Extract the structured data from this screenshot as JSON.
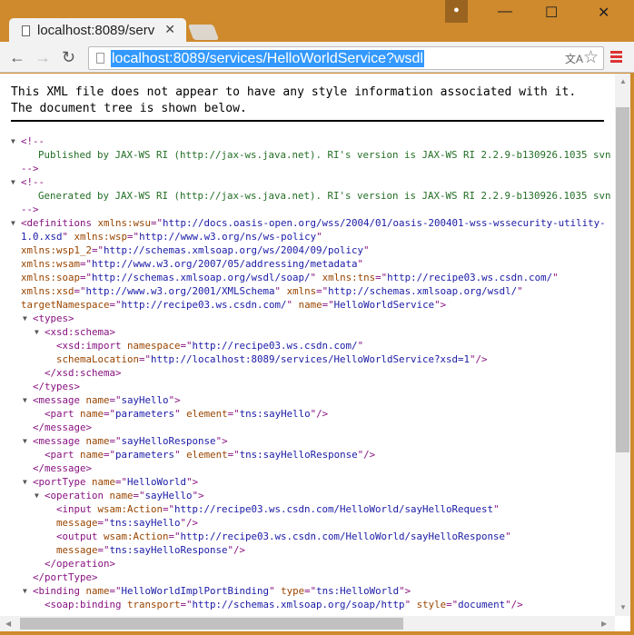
{
  "browser": {
    "tab_title": "localhost:8089/serv",
    "url": "localhost:8089/services/HelloWorldService?wsdl",
    "accent": "#cf8a2d",
    "selection_color": "#3399ff"
  },
  "notice": {
    "line1": "This XML file does not appear to have any style information associated with it.",
    "line2": "The document tree is shown below."
  },
  "colors": {
    "tag": "#881280",
    "attr_name": "#994500",
    "attr_value": "#1a1aa6",
    "comment": "#236e25"
  },
  "lines": [
    {
      "d": 0,
      "a": 1,
      "t": [
        [
          "g",
          "<!--"
        ]
      ]
    },
    {
      "d": 0,
      "b": 1,
      "t": [
        [
          "c",
          "Published by JAX-WS RI (http://jax-ws.java.net). RI's version is JAX-WS RI 2.2.9-b130926.1035 svn"
        ]
      ]
    },
    {
      "d": 0,
      "t": [
        [
          "g",
          "-->"
        ]
      ]
    },
    {
      "d": 0,
      "a": 1,
      "t": [
        [
          "g",
          "<!--"
        ]
      ]
    },
    {
      "d": 0,
      "b": 1,
      "t": [
        [
          "c",
          "Generated by JAX-WS RI (http://jax-ws.java.net). RI's version is JAX-WS RI 2.2.9-b130926.1035 svn"
        ]
      ]
    },
    {
      "d": 0,
      "t": [
        [
          "g",
          "-->"
        ]
      ]
    },
    {
      "d": 0,
      "a": 1,
      "t": [
        [
          "g",
          "<definitions "
        ],
        [
          "n",
          "xmlns:wsu"
        ],
        [
          "g",
          "=\""
        ],
        [
          "v",
          "http://docs.oasis-open.org/wss/2004/01/oasis-200401-wss-wssecurity-utility-"
        ]
      ]
    },
    {
      "d": 0,
      "t": [
        [
          "v",
          "1.0.xsd"
        ],
        [
          "g",
          "\" "
        ],
        [
          "n",
          "xmlns:wsp"
        ],
        [
          "g",
          "=\""
        ],
        [
          "v",
          "http://www.w3.org/ns/ws-policy"
        ],
        [
          "g",
          "\""
        ]
      ]
    },
    {
      "d": 0,
      "t": [
        [
          "n",
          "xmlns:wsp1_2"
        ],
        [
          "g",
          "=\""
        ],
        [
          "v",
          "http://schemas.xmlsoap.org/ws/2004/09/policy"
        ],
        [
          "g",
          "\""
        ]
      ]
    },
    {
      "d": 0,
      "t": [
        [
          "n",
          "xmlns:wsam"
        ],
        [
          "g",
          "=\""
        ],
        [
          "v",
          "http://www.w3.org/2007/05/addressing/metadata"
        ],
        [
          "g",
          "\""
        ]
      ]
    },
    {
      "d": 0,
      "t": [
        [
          "n",
          "xmlns:soap"
        ],
        [
          "g",
          "=\""
        ],
        [
          "v",
          "http://schemas.xmlsoap.org/wsdl/soap/"
        ],
        [
          "g",
          "\" "
        ],
        [
          "n",
          "xmlns:tns"
        ],
        [
          "g",
          "=\""
        ],
        [
          "v",
          "http://recipe03.ws.csdn.com/"
        ],
        [
          "g",
          "\""
        ]
      ]
    },
    {
      "d": 0,
      "t": [
        [
          "n",
          "xmlns:xsd"
        ],
        [
          "g",
          "=\""
        ],
        [
          "v",
          "http://www.w3.org/2001/XMLSchema"
        ],
        [
          "g",
          "\" "
        ],
        [
          "n",
          "xmlns"
        ],
        [
          "g",
          "=\""
        ],
        [
          "v",
          "http://schemas.xmlsoap.org/wsdl/"
        ],
        [
          "g",
          "\""
        ]
      ]
    },
    {
      "d": 0,
      "t": [
        [
          "n",
          "targetNamespace"
        ],
        [
          "g",
          "=\""
        ],
        [
          "v",
          "http://recipe03.ws.csdn.com/"
        ],
        [
          "g",
          "\" "
        ],
        [
          "n",
          "name"
        ],
        [
          "g",
          "=\""
        ],
        [
          "v",
          "HelloWorldService"
        ],
        [
          "g",
          "\">"
        ]
      ]
    },
    {
      "d": 1,
      "a": 1,
      "t": [
        [
          "g",
          "<types>"
        ]
      ]
    },
    {
      "d": 2,
      "a": 1,
      "t": [
        [
          "g",
          "<xsd:schema>"
        ]
      ]
    },
    {
      "d": 3,
      "t": [
        [
          "g",
          "<xsd:import "
        ],
        [
          "n",
          "namespace"
        ],
        [
          "g",
          "=\""
        ],
        [
          "v",
          "http://recipe03.ws.csdn.com/"
        ],
        [
          "g",
          "\""
        ]
      ]
    },
    {
      "d": 3,
      "t": [
        [
          "n",
          "schemaLocation"
        ],
        [
          "g",
          "=\""
        ],
        [
          "v",
          "http://localhost:8089/services/HelloWorldService?xsd=1"
        ],
        [
          "g",
          "\"/>"
        ]
      ]
    },
    {
      "d": 2,
      "t": [
        [
          "g",
          "</xsd:schema>"
        ]
      ]
    },
    {
      "d": 1,
      "t": [
        [
          "g",
          "</types>"
        ]
      ]
    },
    {
      "d": 1,
      "a": 1,
      "t": [
        [
          "g",
          "<message "
        ],
        [
          "n",
          "name"
        ],
        [
          "g",
          "=\""
        ],
        [
          "v",
          "sayHello"
        ],
        [
          "g",
          "\">"
        ]
      ]
    },
    {
      "d": 2,
      "t": [
        [
          "g",
          "<part "
        ],
        [
          "n",
          "name"
        ],
        [
          "g",
          "=\""
        ],
        [
          "v",
          "parameters"
        ],
        [
          "g",
          "\" "
        ],
        [
          "n",
          "element"
        ],
        [
          "g",
          "=\""
        ],
        [
          "v",
          "tns:sayHello"
        ],
        [
          "g",
          "\"/>"
        ]
      ]
    },
    {
      "d": 1,
      "t": [
        [
          "g",
          "</message>"
        ]
      ]
    },
    {
      "d": 1,
      "a": 1,
      "t": [
        [
          "g",
          "<message "
        ],
        [
          "n",
          "name"
        ],
        [
          "g",
          "=\""
        ],
        [
          "v",
          "sayHelloResponse"
        ],
        [
          "g",
          "\">"
        ]
      ]
    },
    {
      "d": 2,
      "t": [
        [
          "g",
          "<part "
        ],
        [
          "n",
          "name"
        ],
        [
          "g",
          "=\""
        ],
        [
          "v",
          "parameters"
        ],
        [
          "g",
          "\" "
        ],
        [
          "n",
          "element"
        ],
        [
          "g",
          "=\""
        ],
        [
          "v",
          "tns:sayHelloResponse"
        ],
        [
          "g",
          "\"/>"
        ]
      ]
    },
    {
      "d": 1,
      "t": [
        [
          "g",
          "</message>"
        ]
      ]
    },
    {
      "d": 1,
      "a": 1,
      "t": [
        [
          "g",
          "<portType "
        ],
        [
          "n",
          "name"
        ],
        [
          "g",
          "=\""
        ],
        [
          "v",
          "HelloWorld"
        ],
        [
          "g",
          "\">"
        ]
      ]
    },
    {
      "d": 2,
      "a": 1,
      "t": [
        [
          "g",
          "<operation "
        ],
        [
          "n",
          "name"
        ],
        [
          "g",
          "=\""
        ],
        [
          "v",
          "sayHello"
        ],
        [
          "g",
          "\">"
        ]
      ]
    },
    {
      "d": 3,
      "t": [
        [
          "g",
          "<input "
        ],
        [
          "n",
          "wsam:Action"
        ],
        [
          "g",
          "=\""
        ],
        [
          "v",
          "http://recipe03.ws.csdn.com/HelloWorld/sayHelloRequest"
        ],
        [
          "g",
          "\""
        ]
      ]
    },
    {
      "d": 3,
      "t": [
        [
          "n",
          "message"
        ],
        [
          "g",
          "=\""
        ],
        [
          "v",
          "tns:sayHello"
        ],
        [
          "g",
          "\"/>"
        ]
      ]
    },
    {
      "d": 3,
      "t": [
        [
          "g",
          "<output "
        ],
        [
          "n",
          "wsam:Action"
        ],
        [
          "g",
          "=\""
        ],
        [
          "v",
          "http://recipe03.ws.csdn.com/HelloWorld/sayHelloResponse"
        ],
        [
          "g",
          "\""
        ]
      ]
    },
    {
      "d": 3,
      "t": [
        [
          "n",
          "message"
        ],
        [
          "g",
          "=\""
        ],
        [
          "v",
          "tns:sayHelloResponse"
        ],
        [
          "g",
          "\"/>"
        ]
      ]
    },
    {
      "d": 2,
      "t": [
        [
          "g",
          "</operation>"
        ]
      ]
    },
    {
      "d": 1,
      "t": [
        [
          "g",
          "</portType>"
        ]
      ]
    },
    {
      "d": 1,
      "a": 1,
      "t": [
        [
          "g",
          "<binding "
        ],
        [
          "n",
          "name"
        ],
        [
          "g",
          "=\""
        ],
        [
          "v",
          "HelloWorldImplPortBinding"
        ],
        [
          "g",
          "\" "
        ],
        [
          "n",
          "type"
        ],
        [
          "g",
          "=\""
        ],
        [
          "v",
          "tns:HelloWorld"
        ],
        [
          "g",
          "\">"
        ]
      ]
    },
    {
      "d": 2,
      "t": [
        [
          "g",
          "<soap:binding "
        ],
        [
          "n",
          "transport"
        ],
        [
          "g",
          "=\""
        ],
        [
          "v",
          "http://schemas.xmlsoap.org/soap/http"
        ],
        [
          "g",
          "\" "
        ],
        [
          "n",
          "style"
        ],
        [
          "g",
          "=\""
        ],
        [
          "v",
          "document"
        ],
        [
          "g",
          "\"/>"
        ]
      ]
    }
  ]
}
